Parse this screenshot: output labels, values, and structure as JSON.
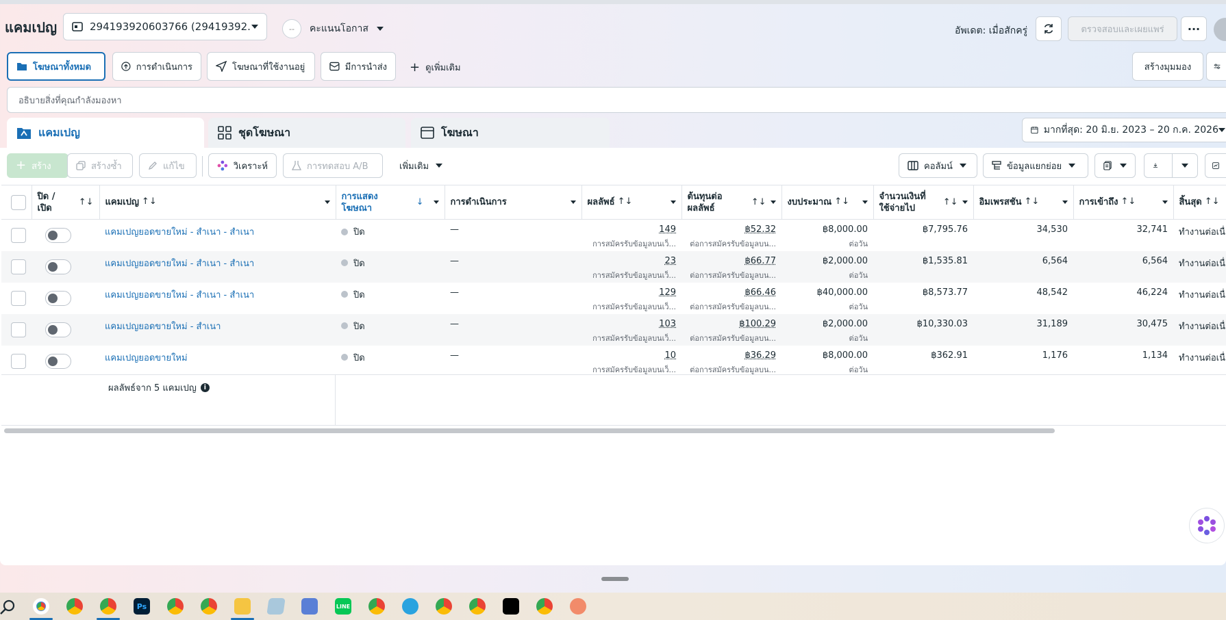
{
  "header": {
    "title": "แคมเปญ",
    "account": "294193920603766 (29419392...",
    "score_label": "คะแนนโอกาส",
    "score_dots": "--",
    "update_text": "อัพเดต: เมื่อสักครู่",
    "review_button": "ตรวจสอบและเผยแพร่"
  },
  "filters": {
    "all_ads": "โฆษณาทั้งหมด",
    "actions": "การดำเนินการ",
    "active_ads": "โฆษณาที่ใช้งานอยู่",
    "delivering": "มีการนำส่ง",
    "see_more": "ดูเพิ่มเติม",
    "create_view": "สร้างมุมมอง"
  },
  "search": {
    "placeholder": "อธิบายสิ่งที่คุณกำลังมองหา"
  },
  "tabs": {
    "campaigns": "แคมเปญ",
    "adsets": "ชุดโฆษณา",
    "ads": "โฆษณา"
  },
  "date_range": "มากที่สุด: 20 มิ.ย. 2023 – 20 ก.ค. 2026",
  "toolbar": {
    "create": "สร้าง",
    "duplicate": "สร้างซ้ำ",
    "edit": "แก้ไข",
    "analyze": "วิเคราะห์",
    "ab_test": "การทดสอบ A/B",
    "more": "เพิ่มเติม",
    "columns": "คอลัมน์",
    "breakdown": "ข้อมูลแยกย่อย"
  },
  "columns": {
    "toggle": "ปิด / เปิด",
    "campaign": "แคมเปญ",
    "delivery": "การแสดง โฆษณา",
    "actions": "การดำเนินการ",
    "results": "ผลลัพธ์",
    "cpr": "ต้นทุนต่อ ผลลัพธ์",
    "budget": "งบประมาณ",
    "spent": "จำนวนเงินที่ ใช้จ่ายไป",
    "impressions": "อิมเพรสชัน",
    "reach": "การเข้าถึง",
    "ends": "สิ้นสุด"
  },
  "rows": [
    {
      "name": "แคมเปญยอดขายใหม่ - สำเนา - สำเนา",
      "status": "ปิด",
      "action": "—",
      "result": "149",
      "result_sub": "การสมัครรับข้อมูลบนเว็...",
      "cpr": "฿52.32",
      "cpr_sub": "ต่อการสมัครรับข้อมูลบน...",
      "budget": "฿8,000.00",
      "budget_sub": "ต่อวัน",
      "spent": "฿7,795.76",
      "impressions": "34,530",
      "reach": "32,741",
      "ends": "ทำงานต่อเนื่"
    },
    {
      "name": "แคมเปญยอดขายใหม่ - สำเนา - สำเนา",
      "status": "ปิด",
      "action": "—",
      "result": "23",
      "result_sub": "การสมัครรับข้อมูลบนเว็...",
      "cpr": "฿66.77",
      "cpr_sub": "ต่อการสมัครรับข้อมูลบน...",
      "budget": "฿2,000.00",
      "budget_sub": "ต่อวัน",
      "spent": "฿1,535.81",
      "impressions": "6,564",
      "reach": "6,564",
      "ends": "ทำงานต่อเนื่"
    },
    {
      "name": "แคมเปญยอดขายใหม่ - สำเนา - สำเนา",
      "status": "ปิด",
      "action": "—",
      "result": "129",
      "result_sub": "การสมัครรับข้อมูลบนเว็...",
      "cpr": "฿66.46",
      "cpr_sub": "ต่อการสมัครรับข้อมูลบน...",
      "budget": "฿40,000.00",
      "budget_sub": "ต่อวัน",
      "spent": "฿8,573.77",
      "impressions": "48,542",
      "reach": "46,224",
      "ends": "ทำงานต่อเนื่"
    },
    {
      "name": "แคมเปญยอดขายใหม่ - สำเนา",
      "status": "ปิด",
      "action": "—",
      "result": "103",
      "result_sub": "การสมัครรับข้อมูลบนเว็...",
      "cpr": "฿100.29",
      "cpr_sub": "ต่อการสมัครรับข้อมูลบน...",
      "budget": "฿2,000.00",
      "budget_sub": "ต่อวัน",
      "spent": "฿10,330.03",
      "impressions": "31,189",
      "reach": "30,475",
      "ends": "ทำงานต่อเนื่"
    },
    {
      "name": "แคมเปญยอดขายใหม่",
      "status": "ปิด",
      "action": "—",
      "result": "10",
      "result_sub": "การสมัครรับข้อมูลบนเว็...",
      "cpr": "฿36.29",
      "cpr_sub": "ต่อการสมัครรับข้อมูลบน...",
      "budget": "฿8,000.00",
      "budget_sub": "ต่อวัน",
      "spent": "฿362.91",
      "impressions": "1,176",
      "reach": "1,134",
      "ends": "ทำงานต่อเนื่"
    }
  ],
  "summary": "ผลลัพธ์จาก 5 แคมเปญ",
  "taskbar": [
    "search-icon",
    "chrome-icon",
    "chrome-icon",
    "chrome-icon",
    "photoshop-icon",
    "chrome-icon",
    "chrome-icon",
    "file-explorer-icon",
    "notepad-icon",
    "network-icon",
    "line-icon",
    "chrome-icon",
    "telegram-icon",
    "chrome-icon",
    "chrome-icon",
    "capcut-icon",
    "chrome-icon",
    "snipping-tool-icon"
  ],
  "colors": {
    "accent": "#1a6fb5",
    "create_disabled": "#c8e6cf"
  }
}
